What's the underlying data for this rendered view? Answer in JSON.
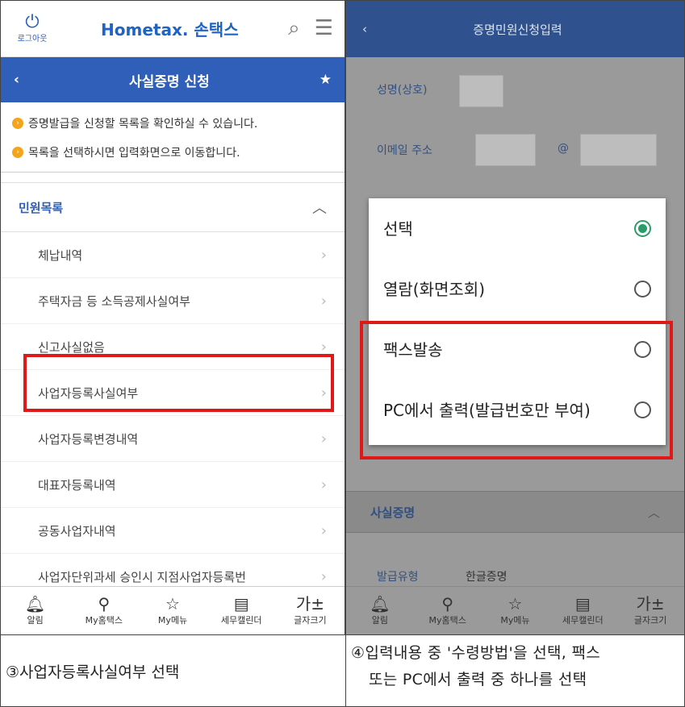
{
  "left": {
    "logout_label": "로그아웃",
    "logout_icon": "power-icon",
    "logo": "Hometax.",
    "logo_sub": "손택스",
    "title": "사실증명 신청",
    "notices": [
      "증명발급을 신청할 목록을 확인하실 수 있습니다.",
      "목록을 선택하시면 입력화면으로 이동합니다."
    ],
    "section": "민원목록",
    "items": [
      "체납내역",
      "주택자금 등 소득공제사실여부",
      "신고사실없음",
      "사업자등록사실여부",
      "사업자등록변경내역",
      "대표자등록내역",
      "공동사업자내역",
      "사업자단위과세 승인시 지점사업자등록번"
    ],
    "highlighted_item": "사업자등록사실여부"
  },
  "tabs": [
    {
      "label": "알림",
      "icon": "bell-icon"
    },
    {
      "label": "My홈택스",
      "icon": "person-icon"
    },
    {
      "label": "My메뉴",
      "icon": "star-icon"
    },
    {
      "label": "세무캘린더",
      "icon": "calendar-icon"
    },
    {
      "label": "글자크기",
      "icon": "font-size-icon"
    }
  ],
  "right": {
    "title": "증명민원신청입력",
    "fields": {
      "name": "성명(상호)",
      "email": "이메일 주소",
      "at": "@"
    },
    "options": [
      {
        "label": "선택",
        "selected": true
      },
      {
        "label": "열람(화면조회)",
        "selected": false
      },
      {
        "label": "팩스발송",
        "selected": false
      },
      {
        "label": "PC에서 출력(발급번호만 부여)",
        "selected": false
      }
    ],
    "section": "사실증명",
    "issue_type_label": "발급유형",
    "issue_type_value": "한글증명"
  },
  "captions": {
    "left": "③사업자등록사실여부 선택",
    "right_line1": "④입력내용 중 '수령방법'을 선택, 팩스",
    "right_line2": "또는 PC에서 출력 중 하나를 선택"
  },
  "colors": {
    "brand_blue": "#2f5fb8",
    "highlight_red": "#e01818",
    "radio_green": "#2a9c6a"
  }
}
